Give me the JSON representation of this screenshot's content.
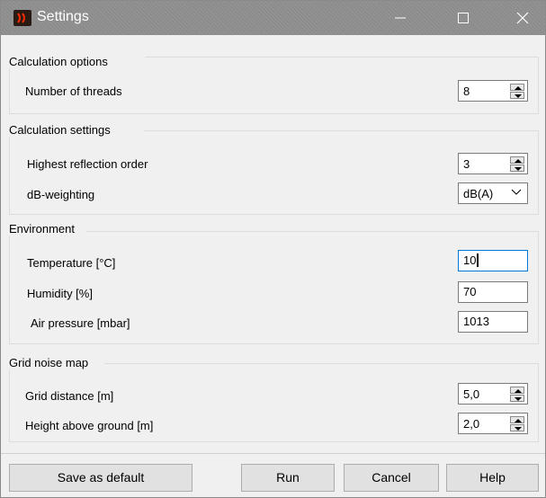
{
  "window": {
    "title": "Settings"
  },
  "sections": {
    "calc_options": {
      "title": "Calculation options",
      "threads": {
        "label": "Number of threads",
        "value": "8"
      }
    },
    "calc_settings": {
      "title": "Calculation settings",
      "reflection": {
        "label": "Highest reflection order",
        "value": "3"
      },
      "weighting": {
        "label": "dB-weighting",
        "value": "dB(A)"
      }
    },
    "environment": {
      "title": "Environment",
      "temperature": {
        "label": "Temperature [°C]",
        "value": "10"
      },
      "humidity": {
        "label": "Humidity [%]",
        "value": "70"
      },
      "pressure": {
        "label": "Air pressure [mbar]",
        "value": "1013"
      }
    },
    "grid": {
      "title": "Grid noise map",
      "distance": {
        "label": "Grid distance [m]",
        "value": "5,0"
      },
      "height": {
        "label": "Height above ground [m]",
        "value": "2,0"
      }
    }
  },
  "buttons": {
    "save_default": "Save as default",
    "run": "Run",
    "cancel": "Cancel",
    "help": "Help"
  },
  "icons": {
    "app": "app-logo-icon",
    "minimize": "minimize-icon",
    "maximize": "maximize-icon",
    "close": "close-icon",
    "spin": "spin-arrows-icon",
    "chevron": "chevron-down-icon"
  },
  "colors": {
    "titlebar": "#8c8c8c",
    "focus_border": "#0078d7",
    "app_icon_accent": "#ff2a00"
  }
}
